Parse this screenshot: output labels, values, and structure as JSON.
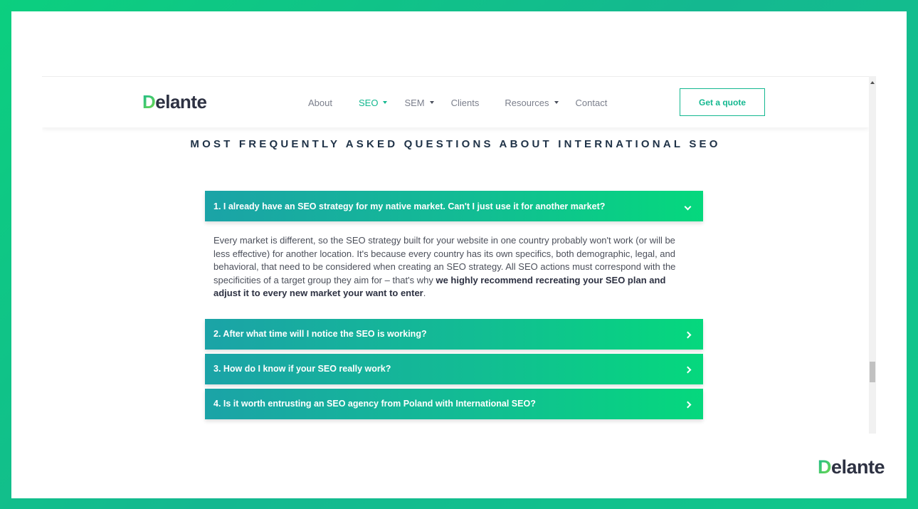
{
  "brand": {
    "logo_initial": "D",
    "logo_rest": "elante"
  },
  "nav": {
    "items": [
      {
        "label": "About",
        "dropdown": false,
        "active": false
      },
      {
        "label": "SEO",
        "dropdown": true,
        "active": true
      },
      {
        "label": "SEM",
        "dropdown": true,
        "active": false
      },
      {
        "label": "Clients",
        "dropdown": false,
        "active": false
      },
      {
        "label": "Resources",
        "dropdown": true,
        "active": false
      },
      {
        "label": "Contact",
        "dropdown": false,
        "active": false
      }
    ],
    "cta_label": "Get a quote"
  },
  "faq": {
    "title": "MOST FREQUENTLY ASKED QUESTIONS ABOUT INTERNATIONAL SEO",
    "items": [
      {
        "question": "1. I already have an SEO strategy for my native market. Can't I just use it for another market?",
        "expanded": true,
        "answer_plain": "Every market is different, so the SEO strategy built for your website in one country probably won't work (or will be less effective) for another location. It's because every country has its own specifics, both demographic, legal, and behavioral, that need to be considered when creating an SEO strategy. All SEO actions must correspond with the specificities of a target group they aim for – that's why ",
        "answer_bold": "we highly recommend recreating your SEO plan and adjust it to every new market your want to enter",
        "answer_end": "."
      },
      {
        "question": "2. After what time will I notice the SEO is working?",
        "expanded": false
      },
      {
        "question": "3. How do I know if your SEO really work?",
        "expanded": false
      },
      {
        "question": "4. Is it worth entrusting an SEO agency from Poland with International SEO?",
        "expanded": false
      }
    ]
  },
  "colors": {
    "accent": "#14b890",
    "gradient_start": "#1ba3a7",
    "gradient_end": "#05d87d",
    "heading": "#1f3247"
  },
  "icons": [
    "chevron-down-icon",
    "chevron-right-icon",
    "caret-down-icon"
  ]
}
